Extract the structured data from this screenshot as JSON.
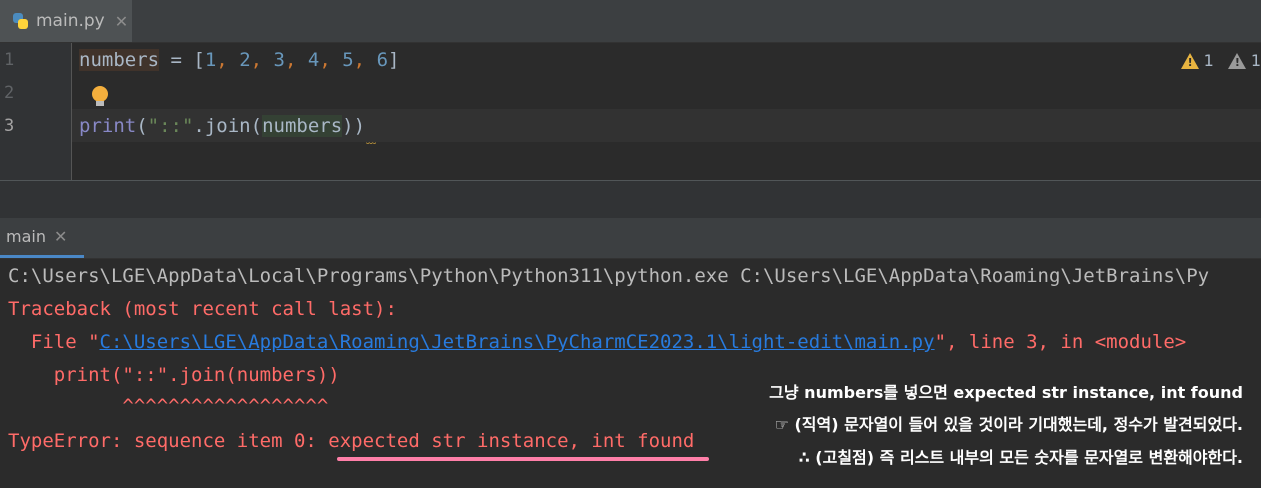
{
  "tab": {
    "filename": "main.py",
    "close": "✕"
  },
  "editor": {
    "line_numbers": [
      "1",
      "2",
      "3"
    ],
    "line1": {
      "var": "numbers",
      "eq": " = [",
      "n1": "1",
      "c1": ", ",
      "n2": "2",
      "c2": ", ",
      "n3": "3",
      "c3": ", ",
      "n4": "4",
      "c4": ", ",
      "n5": "5",
      "c5": ", ",
      "n6": "6",
      "end": "]"
    },
    "line3": {
      "fn": "print",
      "p1": "(",
      "str": "\"::\"",
      "join": ".join(",
      "var": "numbers",
      "end": "))"
    },
    "warnings": [
      {
        "count": "1",
        "color": "#e8b440"
      },
      {
        "count": "1",
        "color": "#9a9a9a"
      }
    ]
  },
  "run": {
    "tab_label": "main",
    "close": "✕"
  },
  "console": {
    "cmd": "C:\\Users\\LGE\\AppData\\Local\\Programs\\Python\\Python311\\python.exe C:\\Users\\LGE\\AppData\\Roaming\\JetBrains\\Py",
    "traceback": "Traceback (most recent call last):",
    "file_prefix": "  File \"",
    "file_link": "C:\\Users\\LGE\\AppData\\Roaming\\JetBrains\\PyCharmCE2023.1\\light-edit\\main.py",
    "file_suffix": "\", line 3, in <module>",
    "code": "    print(\"::\".join(numbers))",
    "carets": "          ^^^^^^^^^^^^^^^^^^",
    "error_prefix": "TypeError: sequence item 0: ",
    "error_msg": "expected str instance, int found"
  },
  "annotations": [
    "그냥 numbers를 넣으면 expected str instance, int found",
    "☞ (직역) 문자열이 들어 있을 것이라 기대했는데,  정수가 발견되었다.",
    "∴ (고칠점) 즉 리스트 내부의 모든 숫자를 문자열로 변환해야한다."
  ],
  "colors": {
    "accent": "#4a88c7",
    "error": "#ff6b68",
    "link": "#287bde",
    "highlight_underline": "#ff7fa8"
  }
}
